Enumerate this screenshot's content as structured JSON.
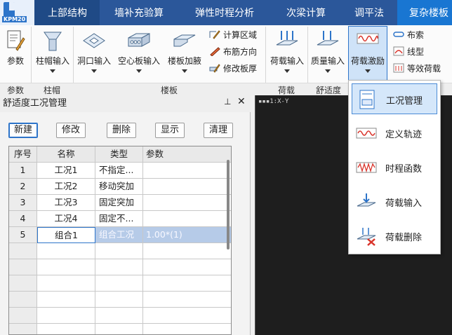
{
  "menu": {
    "logo_text": "KPM20",
    "items": [
      "上部结构",
      "墙补充验算",
      "弹性时程分析",
      "次梁计算",
      "调平法",
      "复杂楼板"
    ]
  },
  "ribbon": {
    "buttons": {
      "param": "参数",
      "cap_input": "柱帽输入",
      "hole_input": "洞口输入",
      "hollow_slab": "空心板输入",
      "slab_haunch": "楼板加腋",
      "load_input": "荷载输入",
      "mass_input": "质量输入",
      "load_excite": "荷载激励"
    },
    "small": {
      "calc_area": "计算区域",
      "rebar_dir": "布筋方向",
      "modify_thickness": "修改板厚",
      "cable": "布索",
      "line_type": "线型",
      "equiv_load": "等效荷载"
    },
    "groups": [
      "参数",
      "柱帽",
      "楼板",
      "荷载",
      "舒适度"
    ]
  },
  "panel": {
    "title": "舒适度工况管理",
    "pin": "ᵖ",
    "close": "✕",
    "buttons": [
      "新建",
      "修改",
      "删除",
      "显示",
      "清理"
    ],
    "columns": [
      "序号",
      "名称",
      "类型",
      "参数"
    ],
    "rows": [
      {
        "no": "1",
        "name": "工况1",
        "type": "不指定...",
        "param": ""
      },
      {
        "no": "2",
        "name": "工况2",
        "type": "移动突加",
        "param": ""
      },
      {
        "no": "3",
        "name": "工况3",
        "type": "固定突加",
        "param": ""
      },
      {
        "no": "4",
        "name": "工况4",
        "type": "固定不...",
        "param": ""
      },
      {
        "no": "5",
        "name": "组合1",
        "type": "组合工况",
        "param": "1.00*(1)"
      }
    ]
  },
  "viewport": {
    "tab_label": "1:X-Y"
  },
  "dropdown": {
    "items": [
      "工况管理",
      "定义轨迹",
      "时程函数",
      "荷载输入",
      "荷载删除"
    ]
  },
  "colors": {
    "menubar": "#2b579a",
    "accent": "#2d74c9",
    "viewport": "#1e1e1e",
    "selection": "#b6cbe8"
  }
}
